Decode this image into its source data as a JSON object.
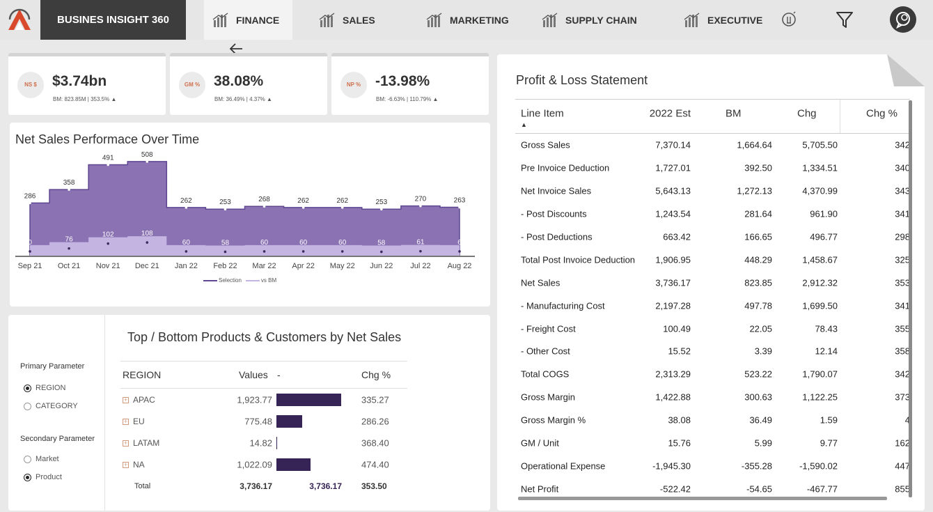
{
  "brand": "BUSINES INSIGHT 360",
  "nav": [
    {
      "label": "FINANCE",
      "active": true
    },
    {
      "label": "SALES",
      "active": false
    },
    {
      "label": "MARKETING",
      "active": false
    },
    {
      "label": "SUPPLY CHAIN",
      "active": false
    },
    {
      "label": "EXECUTIVE",
      "active": false
    }
  ],
  "kpis": [
    {
      "badge": "NS $",
      "value": "$3.74bn",
      "sub": "BM: 823.85M | 353.5% ▲"
    },
    {
      "badge": "GM %",
      "value": "38.08%",
      "sub": "BM: 36.49% | 4.37% ▲"
    },
    {
      "badge": "NP %",
      "value": "-13.98%",
      "sub": "BM: -6.63% | 110.79% ▲"
    }
  ],
  "chart": {
    "title": "Net Sales Performace Over Time",
    "legend": [
      "Selection",
      "vs BM"
    ],
    "colors": {
      "selection": "#8a72b3",
      "bm": "#c4b4e2",
      "line": "#5e4691"
    }
  },
  "chart_data": {
    "type": "area",
    "categories": [
      "Sep 21",
      "Oct 21",
      "Nov 21",
      "Dec 21",
      "Jan 22",
      "Feb 22",
      "Mar 22",
      "Apr 22",
      "May 22",
      "Jun 22",
      "Jul 22",
      "Aug 22"
    ],
    "series": [
      {
        "name": "Selection",
        "values": [
          286,
          358,
          491,
          508,
          262,
          253,
          268,
          262,
          262,
          253,
          270,
          263
        ]
      },
      {
        "name": "vs BM",
        "values": [
          60,
          76,
          102,
          108,
          60,
          58,
          60,
          60,
          60,
          58,
          61,
          60
        ]
      }
    ],
    "data_labels": {
      "Selection": [
        "286",
        "358",
        "491",
        "508",
        "262",
        "253",
        "268",
        "262",
        "262",
        "253",
        "270",
        "263"
      ],
      "vs BM": [
        "0",
        "76",
        "102",
        "108",
        "60",
        "58",
        "60",
        "60",
        "60",
        "58",
        "61",
        "6"
      ]
    },
    "title": "Net Sales Performace Over Time",
    "ylim": [
      0,
      560
    ],
    "grid": false,
    "legend": "bottom-center"
  },
  "slicers": {
    "primary_label": "Primary Parameter",
    "primary_options": [
      {
        "label": "REGION",
        "selected": true
      },
      {
        "label": "CATEGORY",
        "selected": false
      }
    ],
    "secondary_label": "Secondary Parameter",
    "secondary_options": [
      {
        "label": "Market",
        "selected": false
      },
      {
        "label": "Product",
        "selected": true
      }
    ]
  },
  "topbottom": {
    "title": "Top / Bottom Products & Customers by Net Sales",
    "headers": {
      "col1": "REGION",
      "col2": "Values",
      "col3": "-",
      "col4": "Chg %"
    },
    "rows": [
      {
        "name": "APAC",
        "value": "1,923.77",
        "bar": 1923.77,
        "chg": "335.27"
      },
      {
        "name": "EU",
        "value": "775.48",
        "bar": 775.48,
        "chg": "286.26"
      },
      {
        "name": "LATAM",
        "value": "14.82",
        "bar": 14.82,
        "chg": "368.40"
      },
      {
        "name": "NA",
        "value": "1,022.09",
        "bar": 1022.09,
        "chg": "474.40"
      }
    ],
    "total": {
      "label": "Total",
      "value": "3,736.17",
      "bar_value": "3,736.17",
      "chg": "353.50"
    }
  },
  "pl": {
    "title": "Profit & Loss Statement",
    "headers": {
      "item": "Line Item",
      "est": "2022 Est",
      "bm": "BM",
      "chg": "Chg",
      "chgpct": "Chg %"
    },
    "rows": [
      {
        "item": "Gross Sales",
        "est": "7,370.14",
        "bm": "1,664.64",
        "chg": "5,705.50",
        "chgpct": "342"
      },
      {
        "item": "Pre Invoice Deduction",
        "est": "1,727.01",
        "bm": "392.50",
        "chg": "1,334.51",
        "chgpct": "340"
      },
      {
        "item": "Net Invoice Sales",
        "est": "5,643.13",
        "bm": "1,272.13",
        "chg": "4,370.99",
        "chgpct": "343"
      },
      {
        "item": "- Post Discounts",
        "est": "1,243.54",
        "bm": "281.64",
        "chg": "961.90",
        "chgpct": "341"
      },
      {
        "item": "- Post Deductions",
        "est": "663.42",
        "bm": "166.65",
        "chg": "496.77",
        "chgpct": "298"
      },
      {
        "item": "Total Post Invoice Deduction",
        "est": "1,906.95",
        "bm": "448.29",
        "chg": "1,458.67",
        "chgpct": "325"
      },
      {
        "item": "Net Sales",
        "est": "3,736.17",
        "bm": "823.85",
        "chg": "2,912.32",
        "chgpct": "353"
      },
      {
        "item": "- Manufacturing Cost",
        "est": "2,197.28",
        "bm": "497.78",
        "chg": "1,699.50",
        "chgpct": "341"
      },
      {
        "item": "- Freight Cost",
        "est": "100.49",
        "bm": "22.05",
        "chg": "78.43",
        "chgpct": "355"
      },
      {
        "item": "- Other Cost",
        "est": "15.52",
        "bm": "3.39",
        "chg": "12.14",
        "chgpct": "358"
      },
      {
        "item": "Total COGS",
        "est": "2,313.29",
        "bm": "523.22",
        "chg": "1,790.07",
        "chgpct": "342"
      },
      {
        "item": "Gross Margin",
        "est": "1,422.88",
        "bm": "300.63",
        "chg": "1,122.25",
        "chgpct": "373"
      },
      {
        "item": "Gross Margin %",
        "est": "38.08",
        "bm": "36.49",
        "chg": "1.59",
        "chgpct": "4"
      },
      {
        "item": "GM / Unit",
        "est": "15.76",
        "bm": "5.99",
        "chg": "9.77",
        "chgpct": "162"
      },
      {
        "item": "Operational Expense",
        "est": "-1,945.30",
        "bm": "-355.28",
        "chg": "-1,590.02",
        "chgpct": "447"
      },
      {
        "item": "Net Profit",
        "est": "-522.42",
        "bm": "-54.65",
        "chg": "-467.77",
        "chgpct": "855"
      }
    ]
  },
  "icons": {
    "logo": "atliq-logo-icon",
    "nav": "bar-chart-icon",
    "bulb": "lightbulb-icon",
    "filter": "filter-icon",
    "avatar": "chat-avatar-icon",
    "back": "back-arrow-icon"
  }
}
